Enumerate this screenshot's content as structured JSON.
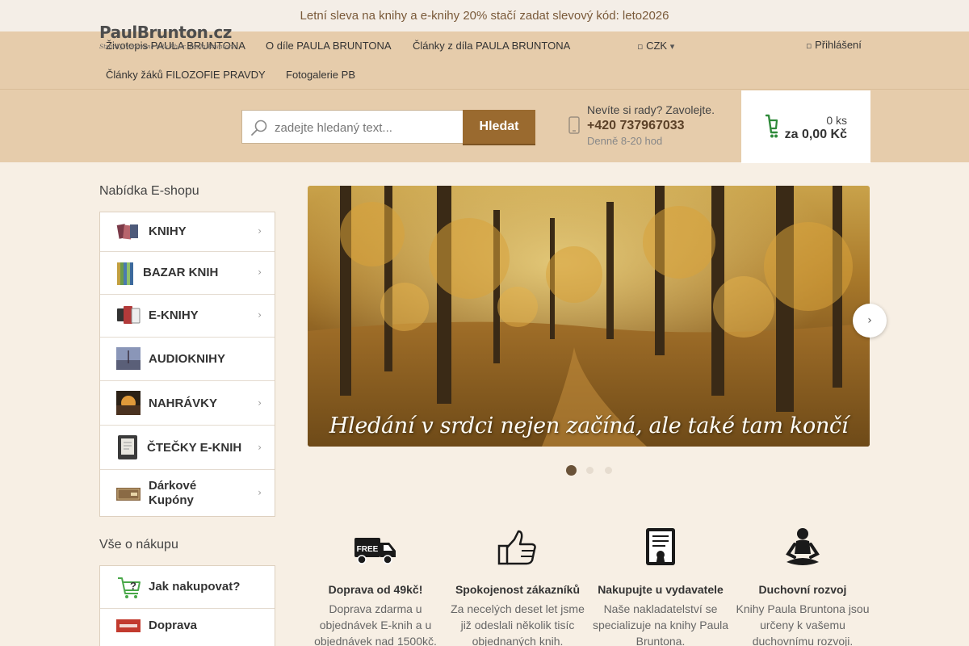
{
  "promo": {
    "text": "Letní sleva na knihy a e-knihy 20% stačí zadat slevový kód: leto2026"
  },
  "topnav": {
    "links": [
      "Životopis PAULA BRUNTONA",
      "O díle PAULA BRUNTONA",
      "Články z díla PAULA BRUNTONA",
      "Články žáků FILOZOFIE PRAVDY",
      "Fotogalerie PB"
    ],
    "currency": "CZK",
    "login": "Přihlášení"
  },
  "logo": {
    "main": "PaulBrunton.cz",
    "sub": "Stránky věnované dílu PhDr. Paula Bruntona"
  },
  "search": {
    "placeholder": "zadejte hledaný text...",
    "button": "Hledat"
  },
  "contact": {
    "question": "Nevíte si rady? Zavolejte.",
    "phone": "+420 737967033",
    "hours": "Denně 8-20 hod"
  },
  "cart": {
    "qty": "0 ks",
    "sum": "za 0,00 Kč"
  },
  "sidebar": {
    "title": "Nabídka E-shopu",
    "items": [
      {
        "label": "KNIHY"
      },
      {
        "label": "BAZAR KNIH"
      },
      {
        "label": "E-KNIHY"
      },
      {
        "label": "AUDIOKNIHY"
      },
      {
        "label": "NAHRÁVKY"
      },
      {
        "label": "ČTEČKY E-KNIH"
      },
      {
        "label": "Dárkové Kupóny"
      }
    ],
    "info_title": "Vše o nákupu",
    "info_items": [
      {
        "label": "Jak nakupovat?"
      },
      {
        "label": "Doprava"
      }
    ]
  },
  "banner": {
    "caption": "Hledání v srdci nejen začíná, ale také tam končí",
    "slide_count": 3,
    "active_slide": 1
  },
  "benefits": [
    {
      "icon": "truck-free-icon",
      "title": "Doprava od 49kč!",
      "text": "Doprava zdarma u objednávek E-knih a u objednávek nad 1500kč."
    },
    {
      "icon": "thumbs-up-icon",
      "title": "Spokojenost zákazníků",
      "text": "Za necelých deset let jsme již odeslali několik tisíc objednaných knih."
    },
    {
      "icon": "certificate-icon",
      "title": "Nakupujte u vydavatele",
      "text": "Naše nakladatelství se specializuje na knihy Paula Bruntona."
    },
    {
      "icon": "meditation-icon",
      "title": "Duchovní rozvoj",
      "text": "Knihy Paula Bruntona jsou určeny k vašemu duchovnímu rozvoji."
    }
  ],
  "colors": {
    "accent": "#9a6a2f",
    "header_bg": "#e6ccab",
    "cart_icon": "#2f8a3a"
  }
}
